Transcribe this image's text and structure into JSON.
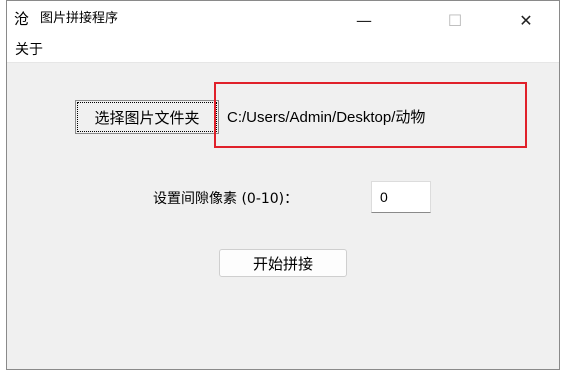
{
  "window": {
    "title": "图片拼接程序",
    "app_icon_glyph": "沧",
    "minimize_glyph": "—",
    "maximize_glyph": "☐",
    "close_glyph": "✕"
  },
  "menu": {
    "items": [
      {
        "label": "关于"
      }
    ]
  },
  "main": {
    "select_folder_button_label": "选择图片文件夹",
    "folder_path": "C:/Users/Admin/Desktop/动物",
    "gap_label": "设置间隙像素 (0-10)：",
    "gap_value": "0",
    "start_button_label": "开始拼接"
  },
  "colors": {
    "highlight_border": "#e0202a",
    "window_background": "#f0f0f0"
  }
}
